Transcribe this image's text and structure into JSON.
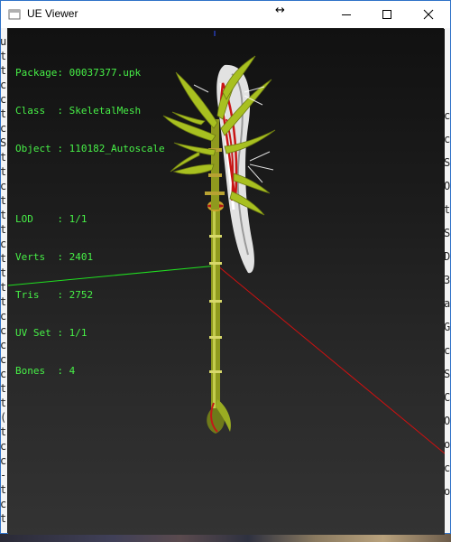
{
  "window": {
    "title": "UE Viewer",
    "resize_cursor_glyph": "↔"
  },
  "info": {
    "package_label": "Package:",
    "package_value": "00037377.upk",
    "class_label": "Class  :",
    "class_value": "SkeletalMesh",
    "object_label": "Object :",
    "object_value": "110182_Autoscale",
    "lod_label": "LOD    :",
    "lod_value": "1/1",
    "verts_label": "Verts  :",
    "verts_value": "2401",
    "tris_label": "Tris   :",
    "tris_value": "2752",
    "uvset_label": "UV Set :",
    "uvset_value": "1/1",
    "bones_label": "Bones  :",
    "bones_value": "4"
  },
  "background_left_text": [
    "u",
    "t",
    "t",
    "c",
    "c",
    "t",
    "c",
    "S",
    "t",
    "t",
    "c",
    "t",
    "t",
    "t",
    "c",
    "t",
    "t",
    "t",
    "t",
    "c",
    "c",
    "c",
    "c",
    "c",
    "t",
    "t",
    "(",
    "t",
    "c",
    "c",
    "-",
    "t",
    "c",
    "t"
  ],
  "background_right_text": [
    "c",
    "c",
    "S",
    "O",
    "t",
    "S",
    "D",
    "3",
    "a",
    "G",
    "c",
    "S",
    "C",
    "O",
    "o",
    "c",
    "o"
  ],
  "colors": {
    "text_green": "#47f047",
    "axis_x": "#d01010",
    "axis_y": "#20e020",
    "stem": "#8f9a1e",
    "leaf": "#a8c020",
    "blade": "#e6e6e6",
    "ribbon": "#c81515"
  }
}
